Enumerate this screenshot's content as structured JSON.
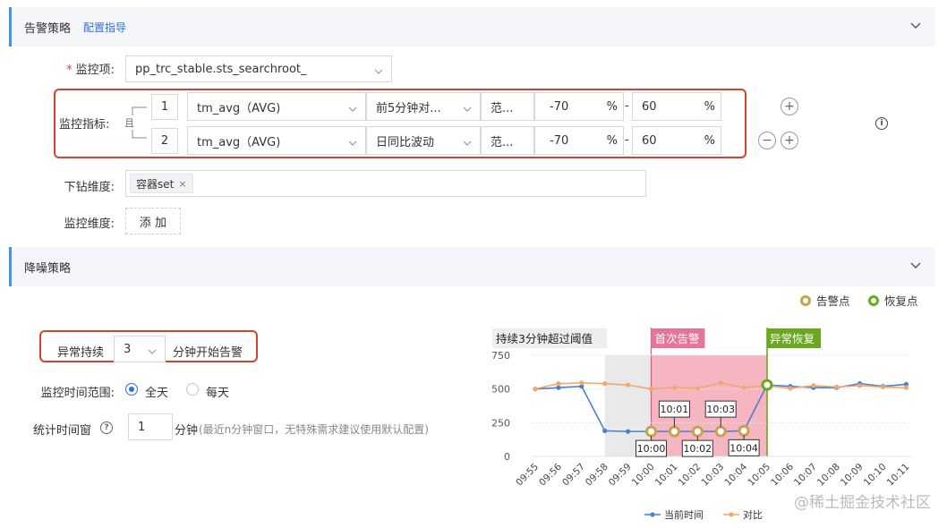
{
  "alert_section": {
    "title": "告警策略",
    "guide_link": "配置指导"
  },
  "monitor_item": {
    "label": "监控项:",
    "value": "pp_trc_stable.sts_searchroot_"
  },
  "metrics": {
    "label": "监控指标:",
    "logic": "且",
    "rows": [
      {
        "index": "1",
        "metric": "tm_avg（AVG)",
        "compare": "前5分钟对...",
        "range": "范...",
        "low": "-70",
        "high": "60",
        "unit": "%",
        "dash": "-"
      },
      {
        "index": "2",
        "metric": "tm_avg（AVG)",
        "compare": "日同比波动",
        "range": "范...",
        "low": "-70",
        "high": "60",
        "unit": "%",
        "dash": "-"
      }
    ],
    "add_glyph": "+",
    "remove_glyph": "−",
    "info_glyph": "i"
  },
  "drill": {
    "label": "下钻维度:",
    "tag": "容器set",
    "tag_close": "×"
  },
  "dims": {
    "label": "监控维度:",
    "add": "添 加"
  },
  "noise_section": {
    "title": "降噪策略"
  },
  "duration": {
    "prefix": "异常持续",
    "value": "3",
    "suffix": "分钟开始告警"
  },
  "time_range": {
    "label": "监控时间范围:",
    "options": [
      "全天",
      "每天"
    ],
    "selected": "全天"
  },
  "window": {
    "label": "统计时间窗",
    "help_glyph": "?",
    "value": "1",
    "unit": "分钟",
    "hint": "(最近n分钟窗口，无特殊需求建议使用默认配置)"
  },
  "colors": {
    "accent": "#2d6fe0",
    "alert": "#c9a24a",
    "recover": "#6aa81e",
    "current": "#4a7fd0",
    "compare": "#f0a86a",
    "alert_zone": "#f5b5c1",
    "normal_zone": "#e9e9e9",
    "red_frame": "#d8412f"
  },
  "chart_data": {
    "type": "line",
    "legend_top": [
      {
        "name": "告警点",
        "color": "#c9a24a"
      },
      {
        "name": "恢复点",
        "color": "#6aa81e"
      }
    ],
    "categories": [
      "09:55",
      "09:56",
      "09:57",
      "09:58",
      "09:59",
      "10:00",
      "10:01",
      "10:02",
      "10:03",
      "10:04",
      "10:05",
      "10:06",
      "10:07",
      "10:08",
      "10:09",
      "10:10",
      "10:11"
    ],
    "series": [
      {
        "name": "当前时间",
        "values": [
          500,
          510,
          520,
          190,
          185,
          185,
          185,
          185,
          185,
          190,
          530,
          520,
          510,
          510,
          540,
          520,
          535
        ]
      },
      {
        "name": "对比",
        "values": [
          500,
          540,
          545,
          540,
          530,
          500,
          510,
          505,
          545,
          510,
          525,
          505,
          525,
          515,
          525,
          515,
          510
        ]
      }
    ],
    "yticks": [
      0,
      250,
      500,
      750
    ],
    "ylim": [
      0,
      750
    ],
    "zones": [
      {
        "label": "持续3分钟超过阈值",
        "from": 3,
        "to": 5
      },
      {
        "label": "首次告警",
        "from": 5,
        "to": 10
      },
      {
        "label": "异常恢复",
        "at": 10
      }
    ],
    "alert_points": [
      {
        "label": "10:00",
        "index": 5
      },
      {
        "label": "10:01",
        "index": 6
      },
      {
        "label": "10:02",
        "index": 7
      },
      {
        "label": "10:03",
        "index": 8
      },
      {
        "label": "10:04",
        "index": 9
      }
    ],
    "recover_point": {
      "index": 10
    },
    "legend_bottom": [
      "当前时间",
      "对比"
    ]
  },
  "watermark": "@稀土掘金技术社区"
}
